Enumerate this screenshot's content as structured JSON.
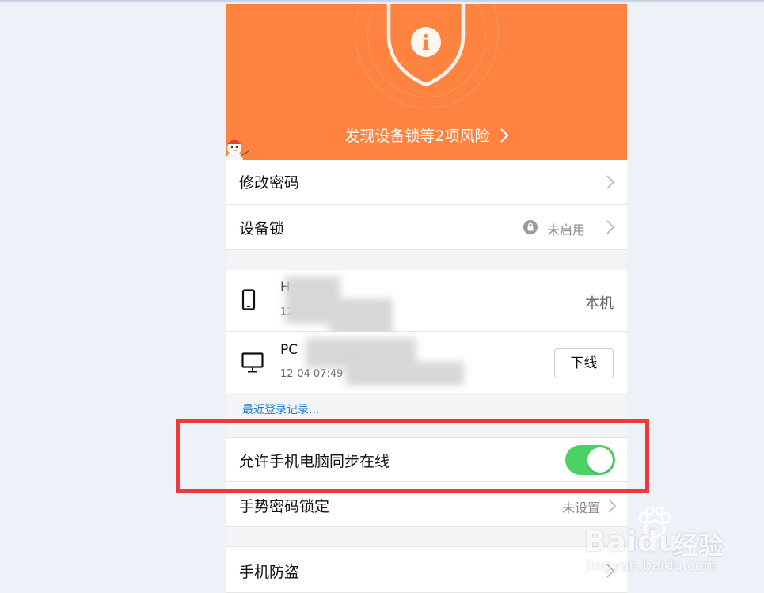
{
  "banner": {
    "risk_text": "发现设备锁等2项风险",
    "shield_glyph": "i",
    "color": "#ff8340"
  },
  "security": {
    "change_password": {
      "label": "修改密码"
    },
    "device_lock": {
      "label": "设备锁",
      "status": "未启用"
    }
  },
  "devices": [
    {
      "name": "H",
      "time": "12-0",
      "type": "phone",
      "status_label": "本机"
    },
    {
      "name": "PC",
      "time": "12-04 07:49",
      "type": "computer",
      "action_label": "下线"
    }
  ],
  "recent_login_link": "最近登录记录...",
  "sync_online": {
    "label": "允许手机电脑同步在线",
    "enabled": true,
    "accent": "#4bd164"
  },
  "gesture_lock": {
    "label": "手势密码锁定",
    "status": "未设置"
  },
  "anti_theft": {
    "label": "手机防盗"
  },
  "watermark": {
    "brand": "Baidu",
    "product": "经验",
    "url": "jingyan.baidu.com"
  },
  "highlight_color": "#ec3a3a"
}
